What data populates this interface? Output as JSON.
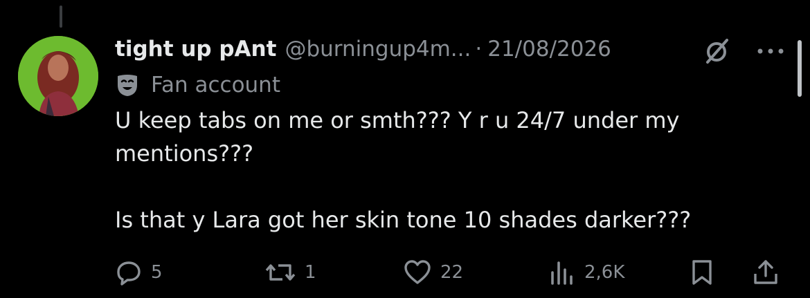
{
  "tweet": {
    "display_name": "tight up pAnt",
    "handle": "@burningup4m...",
    "separator": "·",
    "date": "21/08/2026",
    "label": "Fan account",
    "text_lines": [
      "U keep tabs on me or smth??? Y r u 24/7 under my mentions???",
      "",
      "Is that y Lara got her skin tone 10 shades darker???"
    ]
  },
  "actions": {
    "replies": "5",
    "reposts": "1",
    "likes": "22",
    "views": "2,6K"
  },
  "icons": {
    "avatar_bg": "#6dbb2f",
    "grok": "grok-icon",
    "more": "more-icon",
    "label": "theater-mask-icon",
    "reply": "reply-icon",
    "repost": "repost-icon",
    "like": "heart-icon",
    "views": "views-icon",
    "bookmark": "bookmark-icon",
    "share": "share-icon"
  },
  "colors": {
    "background": "#000000",
    "text": "#e7e9ea",
    "secondary": "#8b9096"
  }
}
